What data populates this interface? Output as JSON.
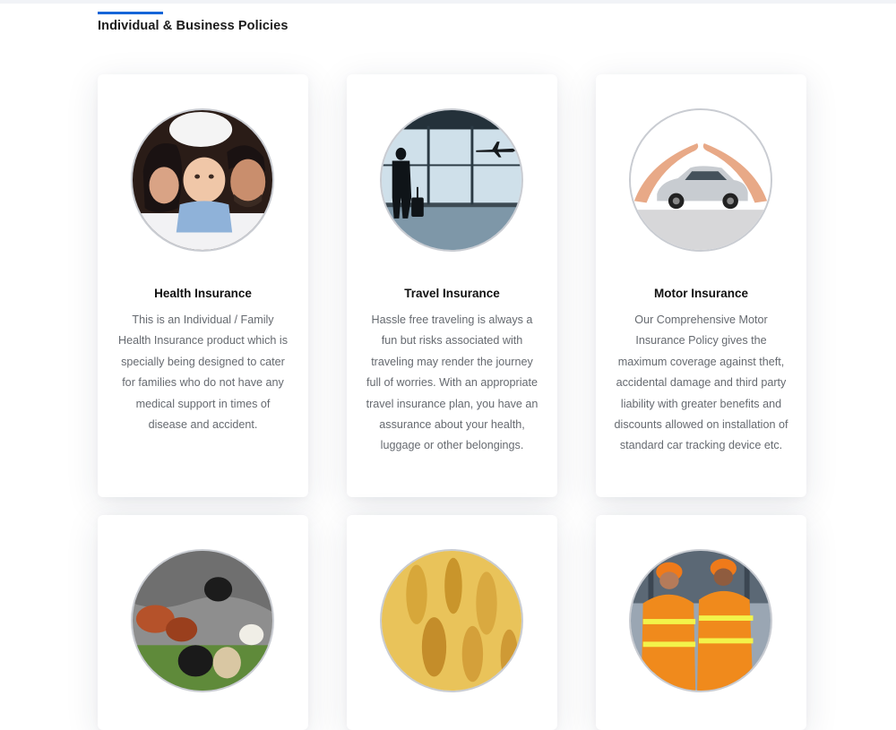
{
  "section": {
    "title": "Individual & Business Policies"
  },
  "cards": [
    {
      "title": "Health Insurance",
      "description": "This is an Individual / Family Health Insurance product which is specially being designed to cater for families who do not have any medical support in times of disease and accident.",
      "image": "family-photo"
    },
    {
      "title": "Travel Insurance",
      "description": "Hassle free traveling is always a fun but risks associated with traveling may render the journey full of worries. With an appropriate travel insurance plan, you have an assurance about your health, luggage or other belongings.",
      "image": "traveler-airport-photo"
    },
    {
      "title": "Motor Insurance",
      "description": "Our Comprehensive Motor Insurance Policy gives the maximum coverage against theft, accidental damage and third party liability with greater benefits and discounts allowed on installation of standard car tracking device etc.",
      "image": "car-protected-hands-photo"
    },
    {
      "image": "livestock-photo"
    },
    {
      "image": "wheat-crop-photo"
    },
    {
      "image": "engineers-photo"
    }
  ],
  "colors": {
    "accent": "#1565d8",
    "title": "#111111",
    "body": "#666a70"
  }
}
